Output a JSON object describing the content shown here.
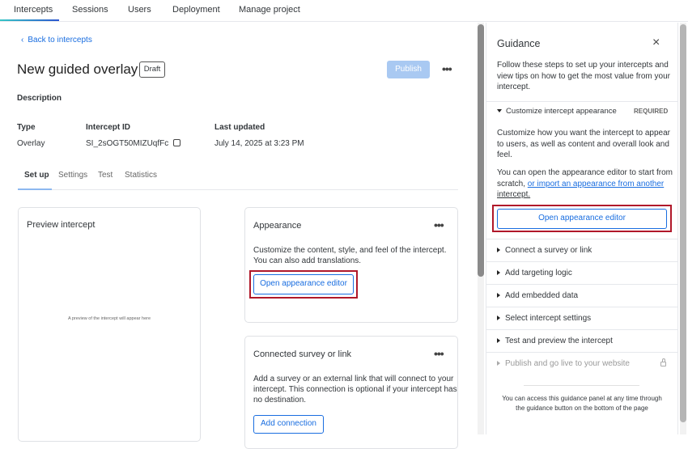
{
  "nav": {
    "tabs": [
      "Intercepts",
      "Sessions",
      "Users",
      "Deployment",
      "Manage project"
    ],
    "active": "Intercepts"
  },
  "back_label": "Back to intercepts",
  "title": "New guided overlay",
  "status_badge": "Draft",
  "publish_label": "Publish",
  "more_label": "•••",
  "description_label": "Description",
  "meta": {
    "type_label": "Type",
    "type_value": "Overlay",
    "id_label": "Intercept ID",
    "id_value": "SI_2sOGT50MIZUqfFc",
    "updated_label": "Last updated",
    "updated_value": "July 14, 2025 at 3:23 PM"
  },
  "subtabs": [
    "Set up",
    "Settings",
    "Test",
    "Statistics"
  ],
  "preview": {
    "title": "Preview intercept",
    "placeholder": "A preview of the intercept will appear here"
  },
  "appearance": {
    "title": "Appearance",
    "line1": "Customize the content, style, and feel of the intercept.",
    "line2": "You can also add translations.",
    "button": "Open appearance editor"
  },
  "connected": {
    "title": "Connected survey or link",
    "line1": "Add a survey or an external link that will connect to your",
    "line2": "intercept. This connection is optional if your intercept has",
    "line3": "no destination.",
    "button": "Add connection"
  },
  "guidance": {
    "title": "Guidance",
    "intro": [
      "Follow these steps to set up your intercepts and",
      "view tips on how to get the most value from your",
      "intercept."
    ],
    "expanded": {
      "label": "Customize intercept appearance",
      "tag": "REQUIRED",
      "p1": [
        "Customize how you want the intercept to appear",
        "to users, as well as content and overall look and",
        "feel."
      ],
      "p2a": "You can open the appearance editor to start from",
      "p2b": "scratch, ",
      "link1": "or import an appearance from another",
      "link2": "intercept.",
      "button": "Open appearance editor"
    },
    "steps": [
      "Connect a survey or link",
      "Add targeting logic",
      "Add embedded data",
      "Select intercept settings",
      "Test and preview the intercept",
      "Publish and go live to your website"
    ],
    "footer": [
      "You can access this guidance panel at any time through",
      "the guidance button on the bottom of the page"
    ]
  },
  "colors": {
    "accent": "#1a6ee0",
    "highlight": "#b0182a"
  }
}
